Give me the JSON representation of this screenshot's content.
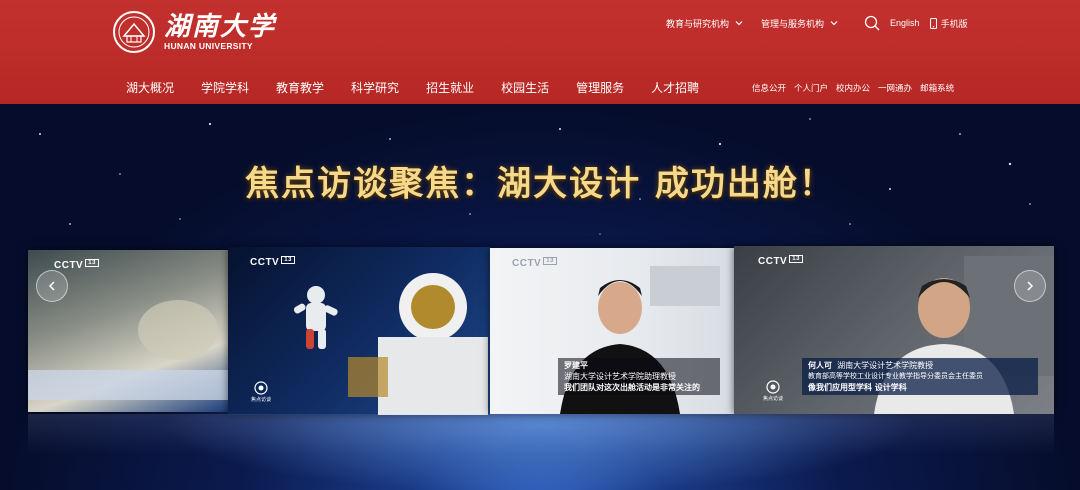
{
  "header": {
    "logo_cn": "湖南大学",
    "logo_en": "HUNAN UNIVERSITY",
    "links": [
      {
        "label": "教育与研究机构"
      },
      {
        "label": "管理与服务机构"
      }
    ],
    "language": "English",
    "mobile": "手机版",
    "nav": [
      "湖大概况",
      "学院学科",
      "教育教学",
      "科学研究",
      "招生就业",
      "校园生活",
      "管理服务",
      "人才招聘"
    ],
    "quick": [
      "信息公开",
      "个人门户",
      "校内办公",
      "一网通办",
      "邮箱系统"
    ]
  },
  "hero": {
    "headline": "焦点访谈聚焦：湖大设计 成功出舱！",
    "cctv_label": "CCTV",
    "channel": "13",
    "program": "焦点访谈",
    "captions": [
      {
        "name": "罗建平",
        "title": "湖南大学设计艺术学院助理教授",
        "quote": "我们团队对这次出舱活动是非常关注的"
      },
      {
        "name": "何人可",
        "title": "湖南大学设计艺术学院教授",
        "title2": "教育部高等学校工业设计专业教学指导分委员会主任委员",
        "quote": "像我们应用型学科 设计学科"
      }
    ]
  },
  "colors": {
    "brand_red": "#b62825",
    "headline_gold": "#f6d98a"
  },
  "icons": [
    "university-seal-icon",
    "chevron-down-icon",
    "search-icon",
    "phone-icon",
    "chevron-left-icon",
    "chevron-right-icon"
  ]
}
